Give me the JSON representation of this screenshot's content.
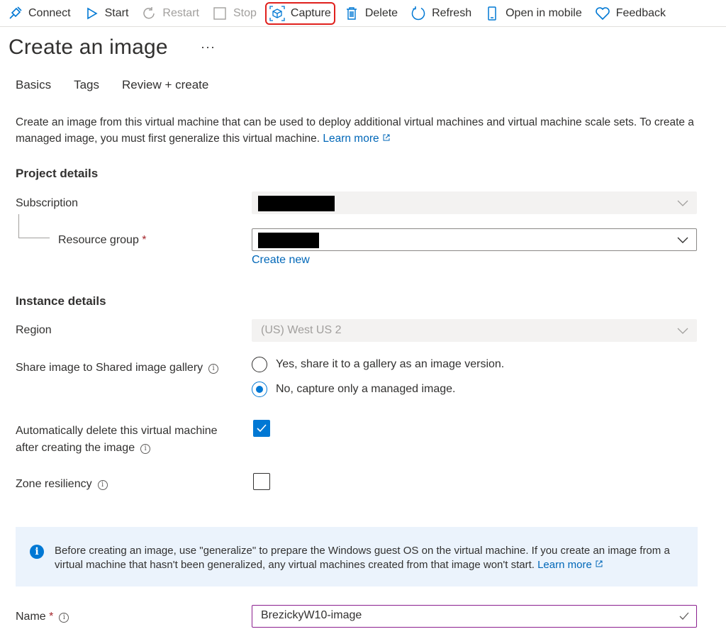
{
  "toolbar": {
    "connect": "Connect",
    "start": "Start",
    "restart": "Restart",
    "stop": "Stop",
    "capture": "Capture",
    "delete": "Delete",
    "refresh": "Refresh",
    "open_mobile": "Open in mobile",
    "feedback": "Feedback"
  },
  "page": {
    "title": "Create an image",
    "more": "···"
  },
  "tabs": [
    "Basics",
    "Tags",
    "Review + create"
  ],
  "description": {
    "text": "Create an image from this virtual machine that can be used to deploy additional virtual machines and virtual machine scale sets. To create a managed image, you must first generalize this virtual machine.",
    "link": "Learn more"
  },
  "project": {
    "heading": "Project details",
    "subscription_label": "Subscription",
    "resource_group_label": "Resource group",
    "required_mark": "*",
    "create_new": "Create new"
  },
  "instance": {
    "heading": "Instance details",
    "region_label": "Region",
    "region_value": "(US) West US 2",
    "share_label": "Share image to Shared image gallery",
    "share_yes": "Yes, share it to a gallery as an image version.",
    "share_no": "No, capture only a managed image.",
    "auto_delete_label_1": "Automatically delete this virtual machine",
    "auto_delete_label_2": "after creating the image",
    "auto_delete_checked": true,
    "zone_label": "Zone resiliency",
    "zone_checked": false
  },
  "notice": {
    "text": "Before creating an image, use \"generalize\" to prepare the Windows guest OS on the virtual machine. If you create an image from a virtual machine that hasn't been generalized, any virtual machines created from that image won't start.",
    "link": "Learn more"
  },
  "name_field": {
    "label": "Name",
    "required_mark": "*",
    "value": "BrezickyW10-image"
  },
  "colors": {
    "accent": "#0078d4",
    "link": "#0067b8",
    "highlight_border": "#e0201d",
    "notice_bg": "#ebf3fc"
  }
}
